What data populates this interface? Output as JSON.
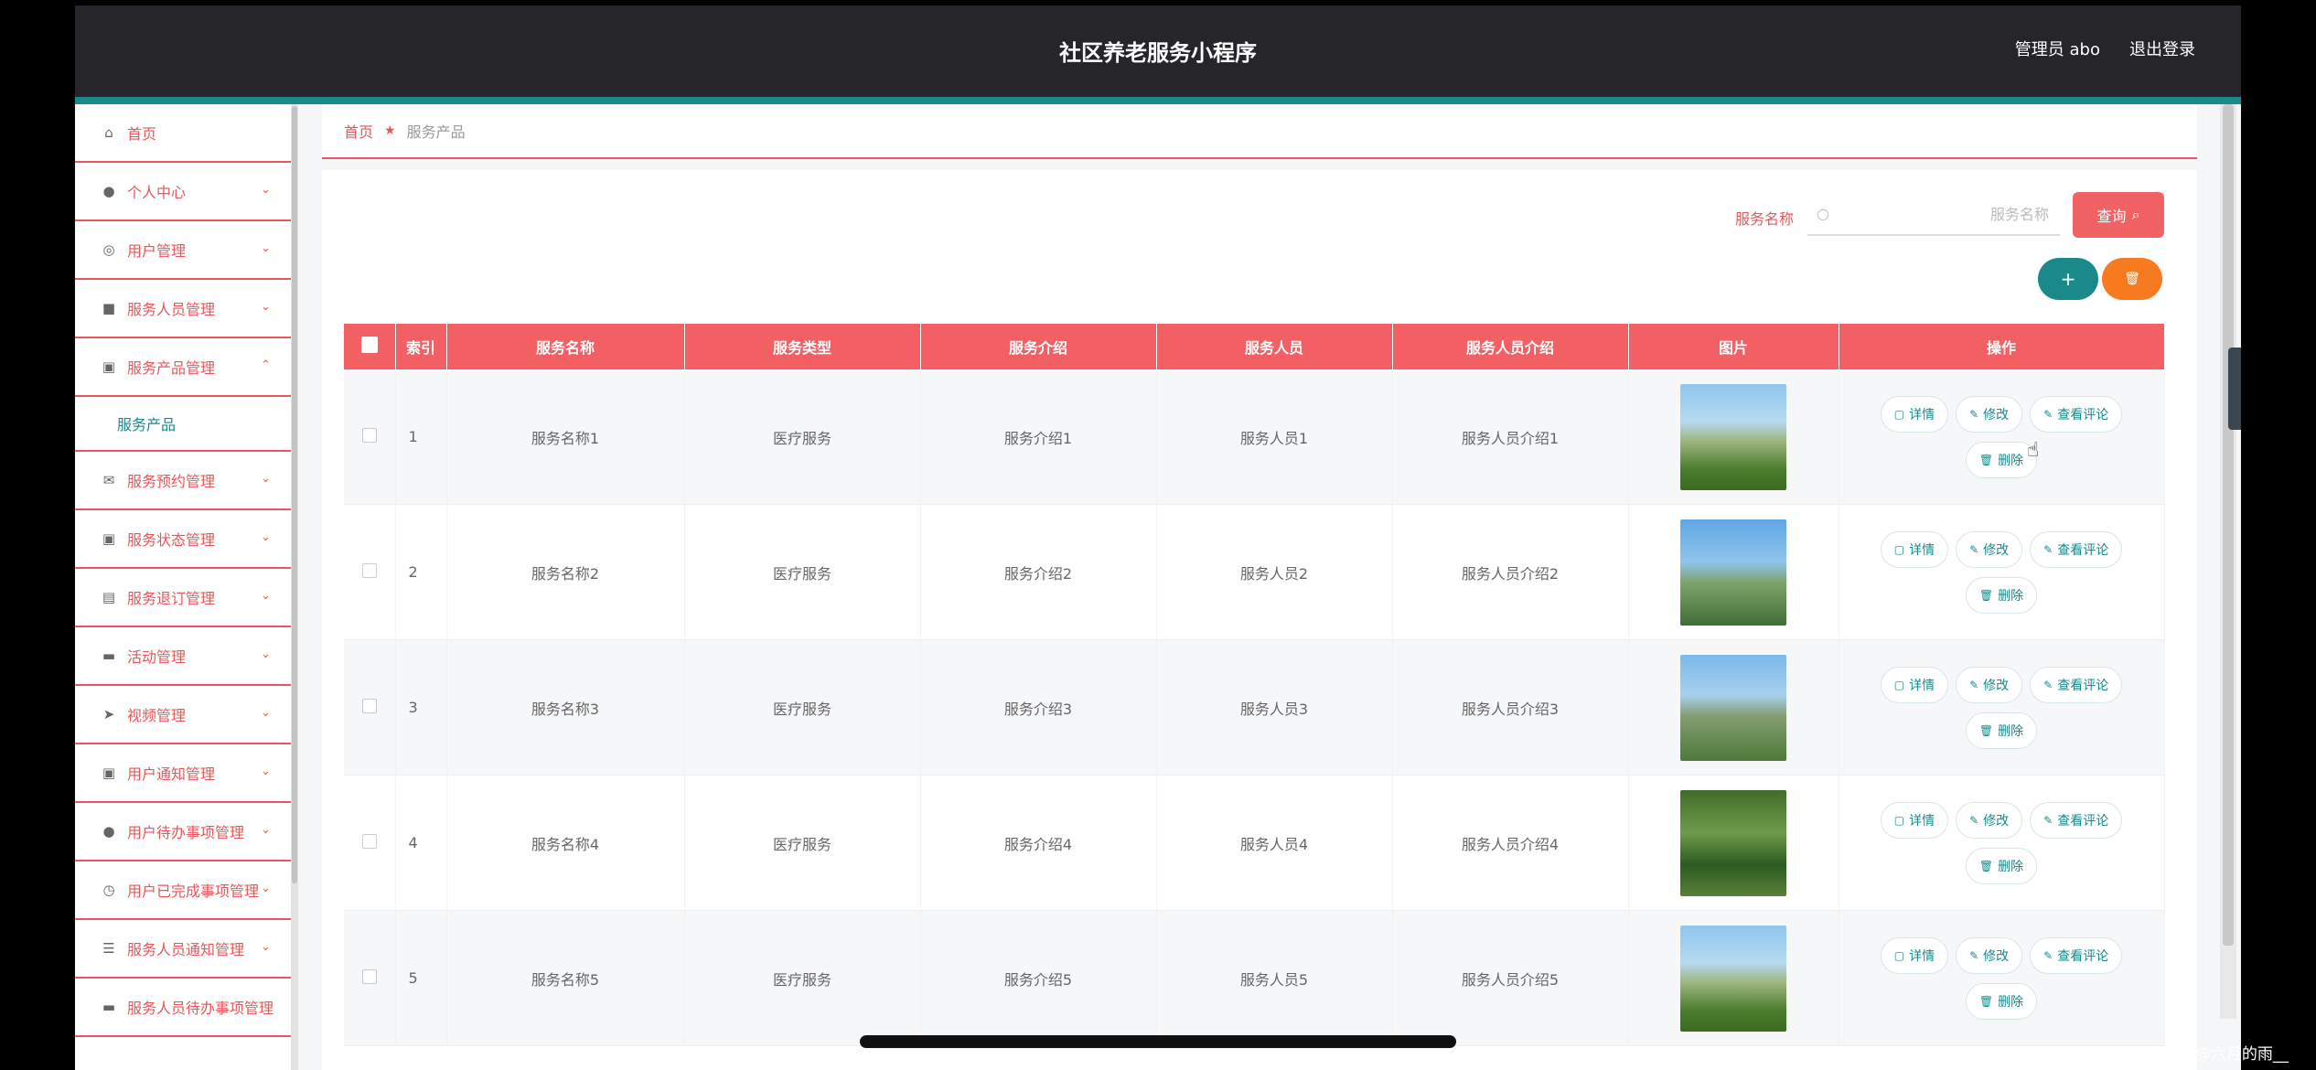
{
  "header": {
    "title": "社区养老服务小程序",
    "user": "管理员 abo",
    "logout": "退出登录"
  },
  "sidebar": {
    "items": [
      {
        "label": "首页",
        "icon": "home-icon"
      },
      {
        "label": "个人中心",
        "icon": "person-icon"
      },
      {
        "label": "用户管理",
        "icon": "user-circle-icon"
      },
      {
        "label": "服务人员管理",
        "icon": "briefcase-icon"
      },
      {
        "label": "服务产品管理",
        "icon": "clipboard-icon",
        "expanded": true,
        "sub": "服务产品"
      },
      {
        "label": "服务预约管理",
        "icon": "mail-icon"
      },
      {
        "label": "服务状态管理",
        "icon": "clipboard-icon"
      },
      {
        "label": "服务退订管理",
        "icon": "chart-icon"
      },
      {
        "label": "活动管理",
        "icon": "comment-icon"
      },
      {
        "label": "视频管理",
        "icon": "send-icon"
      },
      {
        "label": "用户通知管理",
        "icon": "clipboard-icon"
      },
      {
        "label": "用户待办事项管理",
        "icon": "person-icon"
      },
      {
        "label": "用户已完成事项管理",
        "icon": "compass-icon"
      },
      {
        "label": "服务人员通知管理",
        "icon": "list-icon"
      },
      {
        "label": "服务人员待办事项管理",
        "icon": "comment-icon"
      }
    ]
  },
  "breadcrumb": {
    "home": "首页",
    "current": "服务产品"
  },
  "search": {
    "label": "服务名称",
    "placeholder": "服务名称",
    "button": "查询"
  },
  "toolbar": {
    "add": "+",
    "delete": "🗑"
  },
  "table": {
    "headers": [
      "索引",
      "服务名称",
      "服务类型",
      "服务介绍",
      "服务人员",
      "服务人员介绍",
      "图片",
      "操作"
    ],
    "rows": [
      {
        "index": "1",
        "name": "服务名称1",
        "type": "医疗服务",
        "intro": "服务介绍1",
        "staff": "服务人员1",
        "staff_intro": "服务人员介绍1"
      },
      {
        "index": "2",
        "name": "服务名称2",
        "type": "医疗服务",
        "intro": "服务介绍2",
        "staff": "服务人员2",
        "staff_intro": "服务人员介绍2"
      },
      {
        "index": "3",
        "name": "服务名称3",
        "type": "医疗服务",
        "intro": "服务介绍3",
        "staff": "服务人员3",
        "staff_intro": "服务人员介绍3"
      },
      {
        "index": "4",
        "name": "服务名称4",
        "type": "医疗服务",
        "intro": "服务介绍4",
        "staff": "服务人员4",
        "staff_intro": "服务人员介绍4"
      },
      {
        "index": "5",
        "name": "服务名称5",
        "type": "医疗服务",
        "intro": "服务介绍5",
        "staff": "服务人员5",
        "staff_intro": "服务人员介绍5"
      }
    ],
    "actions": {
      "detail": "详情",
      "edit": "修改",
      "review": "查看评论",
      "delete": "删除"
    }
  },
  "watermark": "CSDN @六月的雨__",
  "colors": {
    "accent": "#19898a",
    "brand_red": "#f26063",
    "header_bg": "#25252a",
    "orange": "#f77a1f"
  }
}
